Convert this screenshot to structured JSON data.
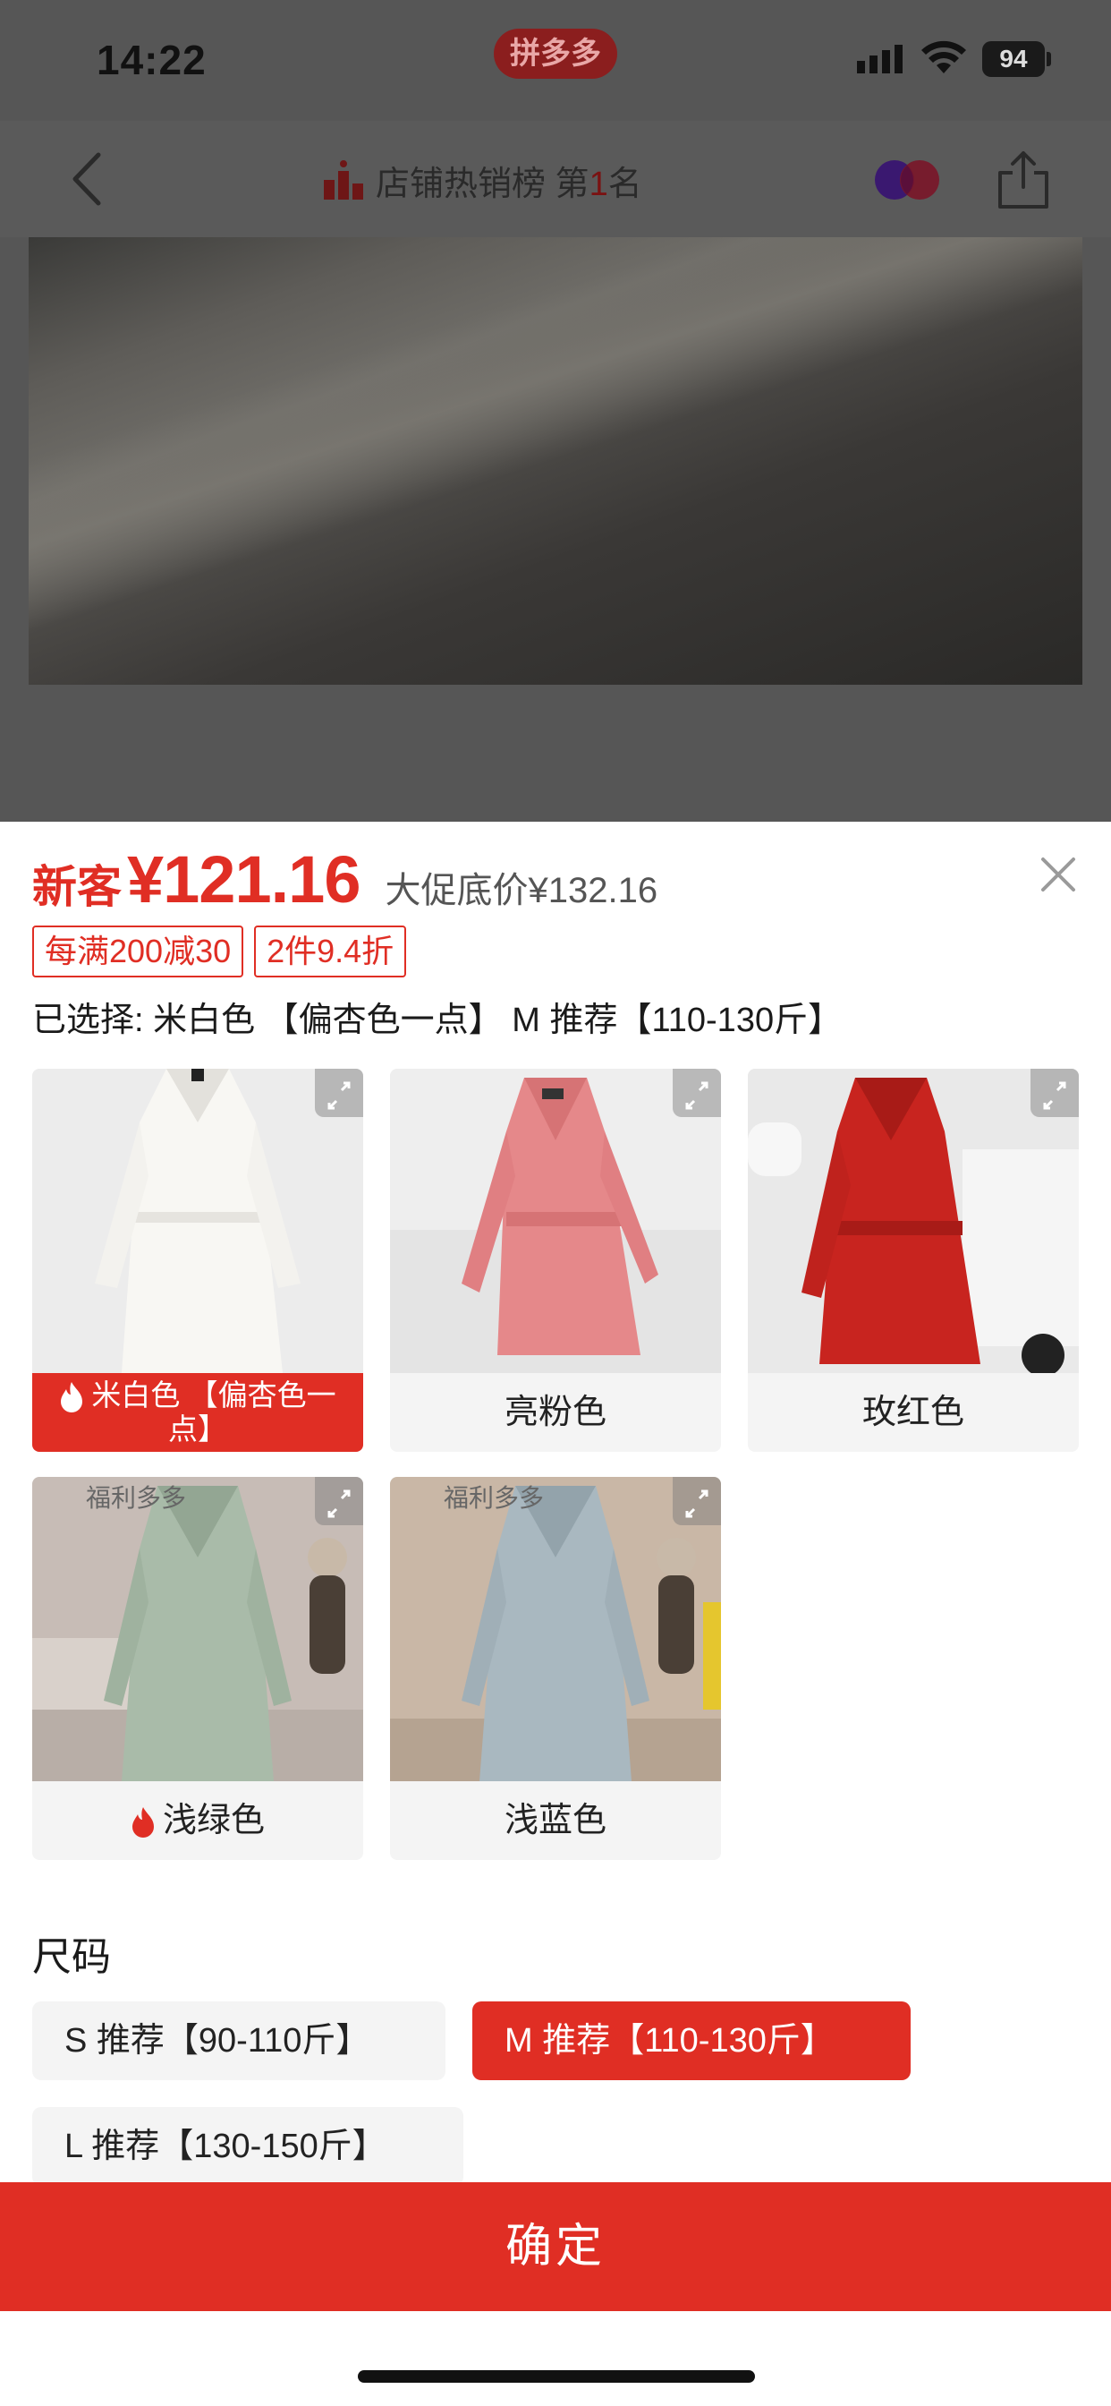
{
  "status_bar": {
    "time": "14:22",
    "app_pill": "拼多多",
    "battery": "94"
  },
  "nav": {
    "rank_prefix": "店铺热销榜 第",
    "rank_num": "1",
    "rank_suffix": "名"
  },
  "sheet": {
    "new_customer_label": "新客",
    "price": "¥121.16",
    "promo_price": "大促底价¥132.16",
    "coupons": [
      "每满200减30",
      "2件9.4折"
    ],
    "selected_text": "已选择: 米白色 【偏杏色一点】 M 推荐【110-130斤】",
    "colors": [
      {
        "label": "米白色 【偏杏色一点】",
        "hot": true,
        "selected": true,
        "swatch": "#f2f0ec"
      },
      {
        "label": "亮粉色",
        "hot": false,
        "selected": false,
        "swatch": "#e88a8c"
      },
      {
        "label": "玫红色",
        "hot": false,
        "selected": false,
        "swatch": "#c8241f"
      },
      {
        "label": "浅绿色",
        "hot": true,
        "selected": false,
        "swatch": "#a9bba9",
        "watermark": "福利多多"
      },
      {
        "label": "浅蓝色",
        "hot": false,
        "selected": false,
        "swatch": "#a9b8c0",
        "watermark": "福利多多"
      }
    ],
    "size_title": "尺码",
    "sizes": [
      {
        "label": "S 推荐【90-110斤】",
        "selected": false
      },
      {
        "label": "M 推荐【110-130斤】",
        "selected": true
      },
      {
        "label": "L 推荐【130-150斤】",
        "selected": false
      }
    ],
    "confirm_label": "确定"
  },
  "colors": {
    "accent": "#e02e24",
    "dim_overlay": "#565656"
  },
  "icons": [
    "back-arrow-icon",
    "podium-icon",
    "dual-circle-icon",
    "share-icon",
    "close-icon",
    "expand-icon",
    "flame-icon",
    "signal-icon",
    "wifi-icon"
  ]
}
